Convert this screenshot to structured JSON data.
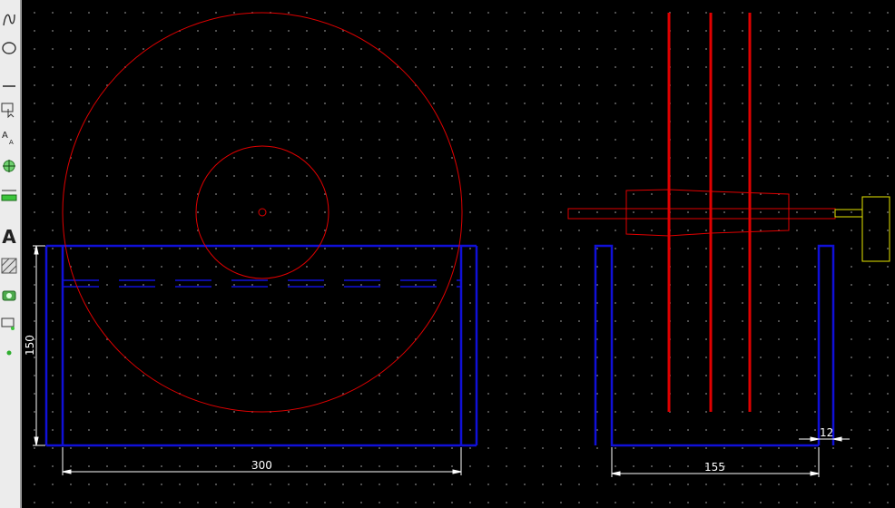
{
  "toolbar": {
    "tools": [
      {
        "name": "spline-tool",
        "icon": "spline-icon"
      },
      {
        "name": "ellipse-tool",
        "icon": "ellipse-icon"
      },
      {
        "name": "line-tool",
        "icon": "line-icon"
      },
      {
        "name": "select-tool",
        "icon": "cursor-select-icon"
      },
      {
        "name": "text-size-tool",
        "icon": "text-size-icon"
      },
      {
        "name": "snap-tool",
        "icon": "snap-target-icon"
      },
      {
        "name": "dimension-tool",
        "icon": "dimension-ruler-icon"
      },
      {
        "name": "text-tool",
        "icon": "text-a-icon",
        "label": "A"
      },
      {
        "name": "hatch-tool",
        "icon": "hatch-icon"
      },
      {
        "name": "camera-tool",
        "icon": "camera-icon"
      },
      {
        "name": "pan-tool",
        "icon": "pan-icon"
      },
      {
        "name": "point-tool",
        "icon": "point-icon"
      }
    ]
  },
  "colors": {
    "background": "#000000",
    "grid_dot": "#5a5a5a",
    "blue_part": "#1010d8",
    "red_geometry": "#e00000",
    "dimension": "#ffffff",
    "handle": "#e6e600"
  },
  "dimensions": {
    "height_left": "150",
    "width_front": "300",
    "width_side": "155",
    "thickness_side": "12"
  }
}
